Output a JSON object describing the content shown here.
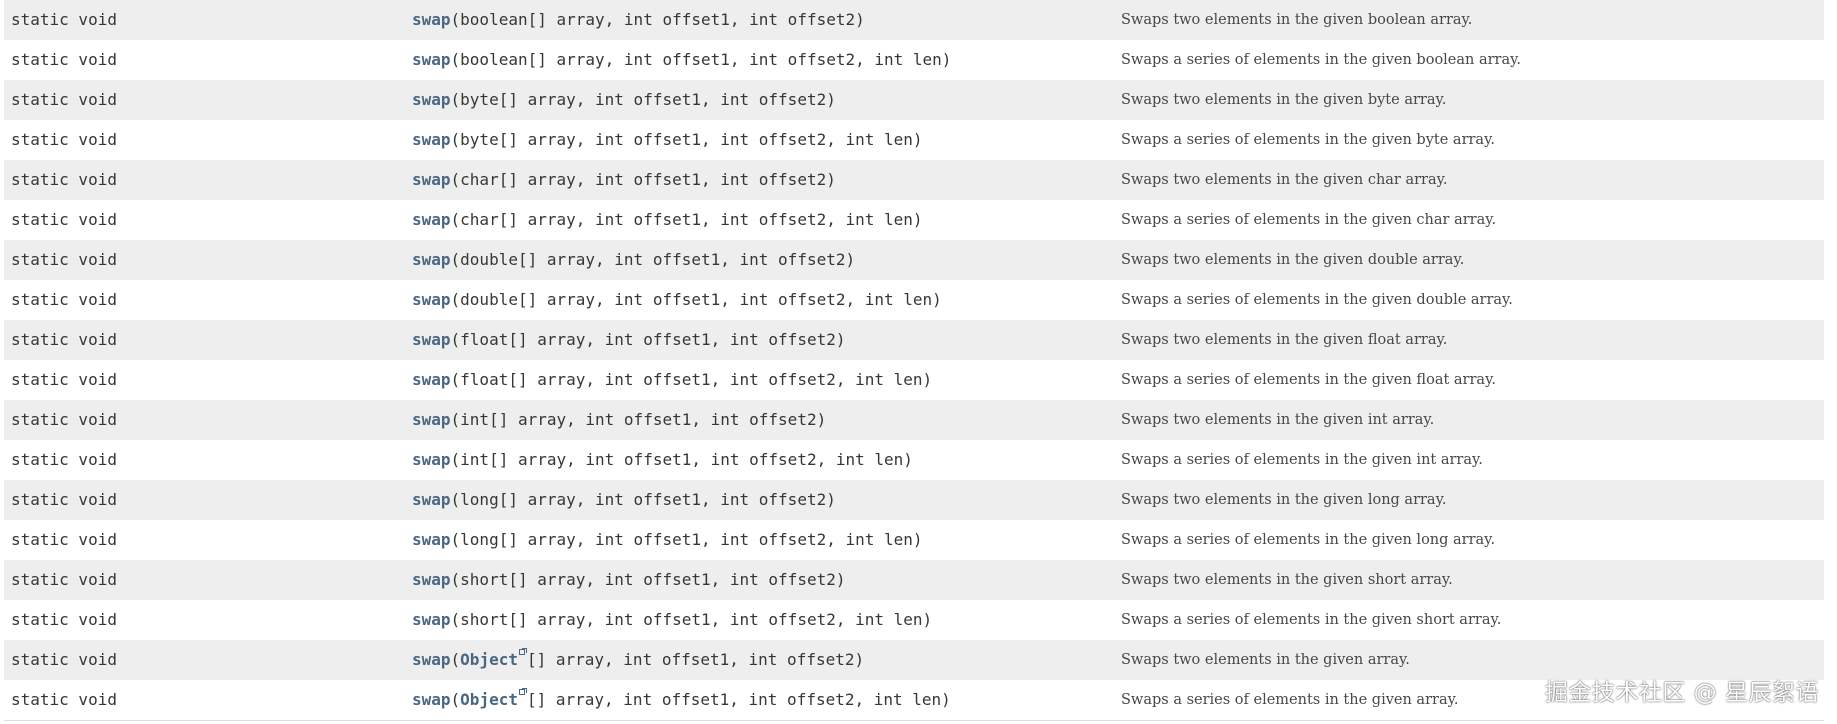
{
  "rows": [
    {
      "modifier": "static void",
      "name": "swap",
      "pre": "(boolean[] array, int offset1, int offset2)",
      "desc": "Swaps two elements in the given boolean array."
    },
    {
      "modifier": "static void",
      "name": "swap",
      "pre": "(boolean[] array, int offset1, int offset2, int len)",
      "desc": "Swaps a series of elements in the given boolean array."
    },
    {
      "modifier": "static void",
      "name": "swap",
      "pre": "(byte[] array, int offset1, int offset2)",
      "desc": "Swaps two elements in the given byte array."
    },
    {
      "modifier": "static void",
      "name": "swap",
      "pre": "(byte[] array, int offset1, int offset2, int len)",
      "desc": "Swaps a series of elements in the given byte array."
    },
    {
      "modifier": "static void",
      "name": "swap",
      "pre": "(char[] array, int offset1, int offset2)",
      "desc": "Swaps two elements in the given char array."
    },
    {
      "modifier": "static void",
      "name": "swap",
      "pre": "(char[] array, int offset1, int offset2, int len)",
      "desc": "Swaps a series of elements in the given char array."
    },
    {
      "modifier": "static void",
      "name": "swap",
      "pre": "(double[] array, int offset1, int offset2)",
      "desc": "Swaps two elements in the given double array."
    },
    {
      "modifier": "static void",
      "name": "swap",
      "pre": "(double[] array, int offset1, int offset2, int len)",
      "desc": "Swaps a series of elements in the given double array."
    },
    {
      "modifier": "static void",
      "name": "swap",
      "pre": "(float[] array, int offset1, int offset2)",
      "desc": "Swaps two elements in the given float array."
    },
    {
      "modifier": "static void",
      "name": "swap",
      "pre": "(float[] array, int offset1, int offset2, int len)",
      "desc": "Swaps a series of elements in the given float array."
    },
    {
      "modifier": "static void",
      "name": "swap",
      "pre": "(int[] array, int offset1, int offset2)",
      "desc": "Swaps two elements in the given int array."
    },
    {
      "modifier": "static void",
      "name": "swap",
      "pre": "(int[] array, int offset1, int offset2, int len)",
      "desc": "Swaps a series of elements in the given int array."
    },
    {
      "modifier": "static void",
      "name": "swap",
      "pre": "(long[] array, int offset1, int offset2)",
      "desc": "Swaps two elements in the given long array."
    },
    {
      "modifier": "static void",
      "name": "swap",
      "pre": "(long[] array, int offset1, int offset2, int len)",
      "desc": "Swaps a series of elements in the given long array."
    },
    {
      "modifier": "static void",
      "name": "swap",
      "pre": "(short[] array, int offset1, int offset2)",
      "desc": "Swaps two elements in the given short array."
    },
    {
      "modifier": "static void",
      "name": "swap",
      "pre": "(short[] array, int offset1, int offset2, int len)",
      "desc": "Swaps a series of elements in the given short array."
    },
    {
      "modifier": "static void",
      "name": "swap",
      "pre": "(",
      "type_link": "Object",
      "post": "[] array, int offset1, int offset2)",
      "desc": "Swaps two elements in the given array."
    },
    {
      "modifier": "static void",
      "name": "swap",
      "pre": "(",
      "type_link": "Object",
      "post": "[] array, int offset1, int offset2, int len)",
      "desc": "Swaps a series of elements in the given array."
    }
  ],
  "watermark": "掘金技术社区 @ 星辰絮语",
  "colors": {
    "method_link": "#4a6782",
    "row_alt": "#eeeeee",
    "text": "#353833"
  }
}
